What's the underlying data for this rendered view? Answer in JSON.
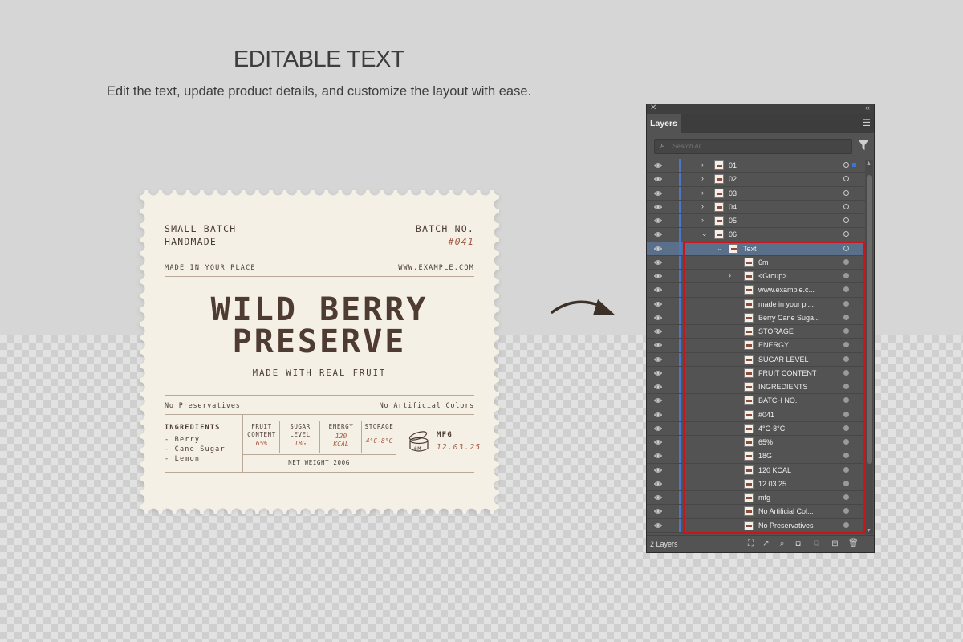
{
  "heading": "EDITABLE TEXT",
  "subheading": "Edit the text, update product details, and customize the layout with ease.",
  "label": {
    "small_batch": "SMALL BATCH",
    "handmade": "HANDMADE",
    "batch_no_label": "BATCH NO.",
    "batch_no_value": "#041",
    "made_in": "MADE IN YOUR PLACE",
    "website": "WWW.EXAMPLE.COM",
    "title_line1": "WILD BERRY",
    "title_line2": "PRESERVE",
    "tagline": "MADE WITH REAL FRUIT",
    "no_preservatives": "No Preservatives",
    "no_artificial": "No Artificial Colors",
    "ingredients_heading": "INGREDIENTS",
    "ingredients": [
      "-  Berry",
      "-  Cane Sugar",
      "-  Lemon"
    ],
    "facts": [
      {
        "label_l1": "FRUIT",
        "label_l2": "CONTENT",
        "value_l1": "65%",
        "value_l2": ""
      },
      {
        "label_l1": "SUGAR",
        "label_l2": "LEVEL",
        "value_l1": "18G",
        "value_l2": ""
      },
      {
        "label_l1": "ENERGY",
        "label_l2": "",
        "value_l1": "120",
        "value_l2": "KCAL"
      },
      {
        "label_l1": "STORAGE",
        "label_l2": "",
        "value_l1": "4°C-8°C",
        "value_l2": ""
      }
    ],
    "net_weight": "NET WEIGHT 200G",
    "jar_badge": "6M",
    "mfg_label": "MFG",
    "mfg_date": "12.03.25"
  },
  "layers_panel": {
    "tab": "Layers",
    "search_placeholder": "Search All",
    "footer_label": "2 Layers",
    "rows": [
      {
        "name": "01",
        "indent": 0,
        "chevron": "right",
        "selected": false
      },
      {
        "name": "02",
        "indent": 0,
        "chevron": "right",
        "selected": false
      },
      {
        "name": "03",
        "indent": 0,
        "chevron": "right",
        "selected": false
      },
      {
        "name": "04",
        "indent": 0,
        "chevron": "right",
        "selected": false
      },
      {
        "name": "05",
        "indent": 0,
        "chevron": "right",
        "selected": false
      },
      {
        "name": "06",
        "indent": 0,
        "chevron": "down",
        "selected": false
      },
      {
        "name": "Text",
        "indent": 1,
        "chevron": "down",
        "selected": true
      },
      {
        "name": "6m",
        "indent": 2,
        "chevron": "",
        "selected": false
      },
      {
        "name": "<Group>",
        "indent": 2,
        "chevron": "right",
        "selected": false
      },
      {
        "name": "www.example.c...",
        "indent": 2,
        "chevron": "",
        "selected": false
      },
      {
        "name": "made in your pl...",
        "indent": 2,
        "chevron": "",
        "selected": false
      },
      {
        "name": "Berry Cane Suga...",
        "indent": 2,
        "chevron": "",
        "selected": false
      },
      {
        "name": "STORAGE",
        "indent": 2,
        "chevron": "",
        "selected": false
      },
      {
        "name": "ENERGY",
        "indent": 2,
        "chevron": "",
        "selected": false
      },
      {
        "name": "SUGAR LEVEL",
        "indent": 2,
        "chevron": "",
        "selected": false
      },
      {
        "name": "FRUIT CONTENT",
        "indent": 2,
        "chevron": "",
        "selected": false
      },
      {
        "name": "INGREDIENTS",
        "indent": 2,
        "chevron": "",
        "selected": false
      },
      {
        "name": "BATCH NO.",
        "indent": 2,
        "chevron": "",
        "selected": false
      },
      {
        "name": "#041",
        "indent": 2,
        "chevron": "",
        "selected": false
      },
      {
        "name": "4°C-8°C",
        "indent": 2,
        "chevron": "",
        "selected": false
      },
      {
        "name": "65%",
        "indent": 2,
        "chevron": "",
        "selected": false
      },
      {
        "name": "18G",
        "indent": 2,
        "chevron": "",
        "selected": false
      },
      {
        "name": "120 KCAL",
        "indent": 2,
        "chevron": "",
        "selected": false
      },
      {
        "name": "12.03.25",
        "indent": 2,
        "chevron": "",
        "selected": false
      },
      {
        "name": "mfg",
        "indent": 2,
        "chevron": "",
        "selected": false
      },
      {
        "name": "No Artificial Col...",
        "indent": 2,
        "chevron": "",
        "selected": false
      },
      {
        "name": "No Preservatives",
        "indent": 2,
        "chevron": "",
        "selected": false
      }
    ]
  },
  "colors": {
    "page_bg": "#d6d6d6",
    "label_bg": "#f4f0e5",
    "ink": "#4a3b33",
    "accent_red": "#a5573f",
    "panel_bg": "#535353",
    "selection": "#5a6f8a",
    "layer_color": "#4a78c8",
    "highlight_box": "#c8161d"
  }
}
